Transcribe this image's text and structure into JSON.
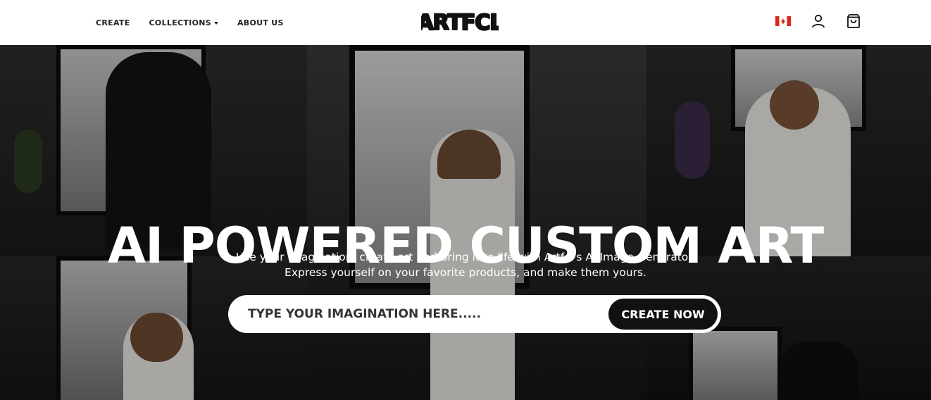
{
  "header": {
    "nav": [
      {
        "label": "CREATE"
      },
      {
        "label": "COLLECTIONS"
      },
      {
        "label": "ABOUT US"
      }
    ],
    "logo_text": "ARTFCL",
    "icons": [
      "canada-flag-icon",
      "user-icon",
      "shopping-bag-icon"
    ]
  },
  "hero": {
    "title": "AI POWERED CUSTOM ART",
    "subtitle_line1": "Use your imagination, create art and bring it to life with Artfcl's AI Image Generator.",
    "subtitle_line2": "Express yourself on your favorite products, and make them yours.",
    "search": {
      "placeholder": "TYPE YOUR IMAGINATION HERE.....",
      "value": ""
    },
    "cta_label": "CREATE NOW"
  },
  "colors": {
    "accent": "#111111",
    "flag_red": "#d52b1e",
    "hero_text": "#ffffff"
  }
}
